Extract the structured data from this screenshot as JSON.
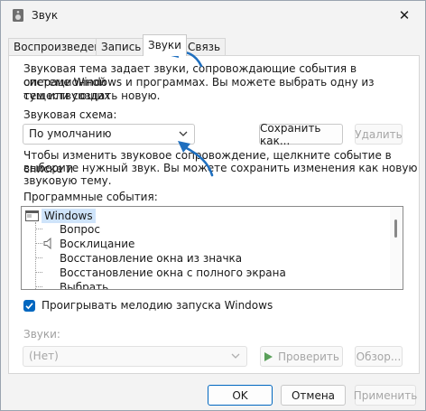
{
  "window": {
    "title": "Звук"
  },
  "tabs": [
    "Воспроизведение",
    "Запись",
    "Звуки",
    "Связь"
  ],
  "theme_description": [
    "Звуковая тема задает звуки, сопровождающие события в операционной",
    "системе Windows и программах. Вы можете выбрать одну из существующих",
    "тем или создать новую."
  ],
  "scheme": {
    "label": "Звуковая схема:",
    "selected": "По умолчанию",
    "save_label": "Сохранить как...",
    "delete_label": "Удалить"
  },
  "change_description": [
    "Чтобы изменить звуковое сопровождение, щелкните событие в списке и",
    "выберите нужный звук. Вы можете сохранить изменения как новую",
    "звуковую тему."
  ],
  "events": {
    "label": "Программные события:",
    "root": "Windows",
    "items": [
      "Вопрос",
      "Восклицание",
      "Восстановление окна из значка",
      "Восстановление окна с полного экрана",
      "Выбрать"
    ]
  },
  "startup_checkbox": {
    "label": "Проигрывать мелодию запуска Windows",
    "checked": true
  },
  "sounds": {
    "label": "Звуки:",
    "selected": "(Нет)",
    "test_label": "Проверить",
    "browse_label": "Обзор..."
  },
  "footer": {
    "ok": "OK",
    "cancel": "Отмена",
    "apply": "Применить"
  },
  "colors": {
    "accent": "#0067c0",
    "annotation_arrow": "#1f6fbf",
    "selection": "#cfe4fa"
  }
}
